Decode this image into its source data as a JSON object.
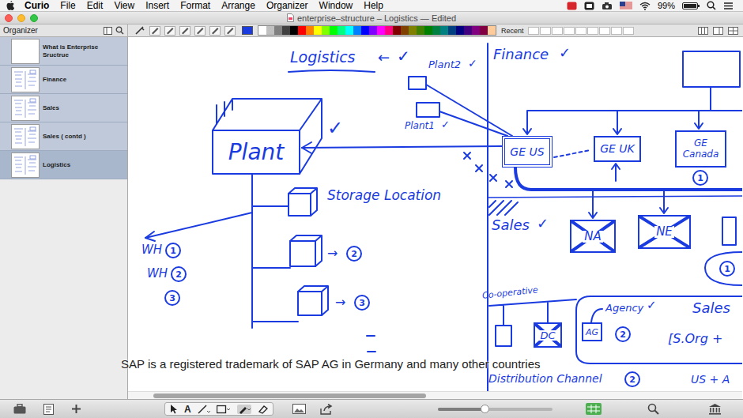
{
  "menu_bar": {
    "app": "Curio",
    "items": [
      "File",
      "Edit",
      "View",
      "Insert",
      "Format",
      "Arrange",
      "Organizer",
      "Window",
      "Help"
    ],
    "battery": "99%"
  },
  "window": {
    "title": "enterprise–structure – Logistics — Edited"
  },
  "toolbar": {
    "organizer_label": "Organizer",
    "current_color": "#1a3be0",
    "recent_label": "Recent",
    "palette": [
      {
        "color": "#ffffff"
      },
      {
        "color": "#c0c0c0"
      },
      {
        "color": "#808080"
      },
      {
        "color": "#404040"
      },
      {
        "color": "#000000"
      },
      {
        "color": "#ff0000"
      },
      {
        "color": "#ff8000"
      },
      {
        "color": "#ffff00"
      },
      {
        "color": "#80ff00"
      },
      {
        "color": "#00ff00"
      },
      {
        "color": "#00ff80"
      },
      {
        "color": "#00ffff"
      },
      {
        "color": "#0080ff"
      },
      {
        "color": "#0000ff"
      },
      {
        "color": "#8000ff"
      },
      {
        "color": "#ff00ff"
      },
      {
        "color": "#ff0080"
      },
      {
        "color": "#800000"
      },
      {
        "color": "#804000"
      },
      {
        "color": "#808000"
      },
      {
        "color": "#408000"
      },
      {
        "color": "#008000"
      },
      {
        "color": "#008040"
      },
      {
        "color": "#008080"
      },
      {
        "color": "#004080"
      },
      {
        "color": "#000080"
      },
      {
        "color": "#400080"
      },
      {
        "color": "#800080"
      },
      {
        "color": "#800040"
      },
      {
        "color": "#ffcc99"
      }
    ]
  },
  "sidebar": {
    "items": [
      {
        "label": "What is Enterprise Sructrue",
        "selected": false
      },
      {
        "label": "Finance",
        "selected": false
      },
      {
        "label": "Sales",
        "selected": false
      },
      {
        "label": "Sales ( contd )",
        "selected": false
      },
      {
        "label": "Logistics",
        "selected": true
      }
    ]
  },
  "canvas": {
    "tick": "✓",
    "arrow_left": "←",
    "arrow_right": "→",
    "logistics": {
      "title": "Logistics",
      "plants": [
        "Plant2",
        "Plant1"
      ],
      "plant": "Plant",
      "storage_location": "Storage Location",
      "storage_numbers": [
        "2",
        "3"
      ],
      "warehouses": [
        {
          "label": "WH",
          "number": "1"
        },
        {
          "label": "WH",
          "number": "2"
        }
      ],
      "extra_number": "3"
    },
    "finance": {
      "title": "Finance",
      "company_codes": [
        {
          "label": "GE US",
          "selected": true
        },
        {
          "label": "GE UK",
          "selected": false
        },
        {
          "label": "GE Canada",
          "selected": false
        }
      ],
      "badge": "1"
    },
    "sales": {
      "title": "Sales",
      "sales_orgs": [
        {
          "label": "NA",
          "crossed": true
        },
        {
          "label": "NE",
          "crossed": true
        }
      ],
      "org_badge": "1",
      "cooperative": "Co-operative",
      "channels": [
        {
          "label": "DC",
          "crossed": true
        },
        {
          "label": "AG",
          "crossed": false
        }
      ],
      "agency": "Agency",
      "agency_badge": "2",
      "sales_area": "Sales",
      "sales_area_formula": "[S.Org +",
      "distribution_channel": "Distribution Channel",
      "channel_badge": "2",
      "country": "US + A"
    }
  },
  "caption": "SAP is a registered trademark of SAP AG in Germany and many other countries",
  "bottom_bar": {
    "text_tool": "A",
    "zoom": {
      "level": 0.41
    }
  }
}
